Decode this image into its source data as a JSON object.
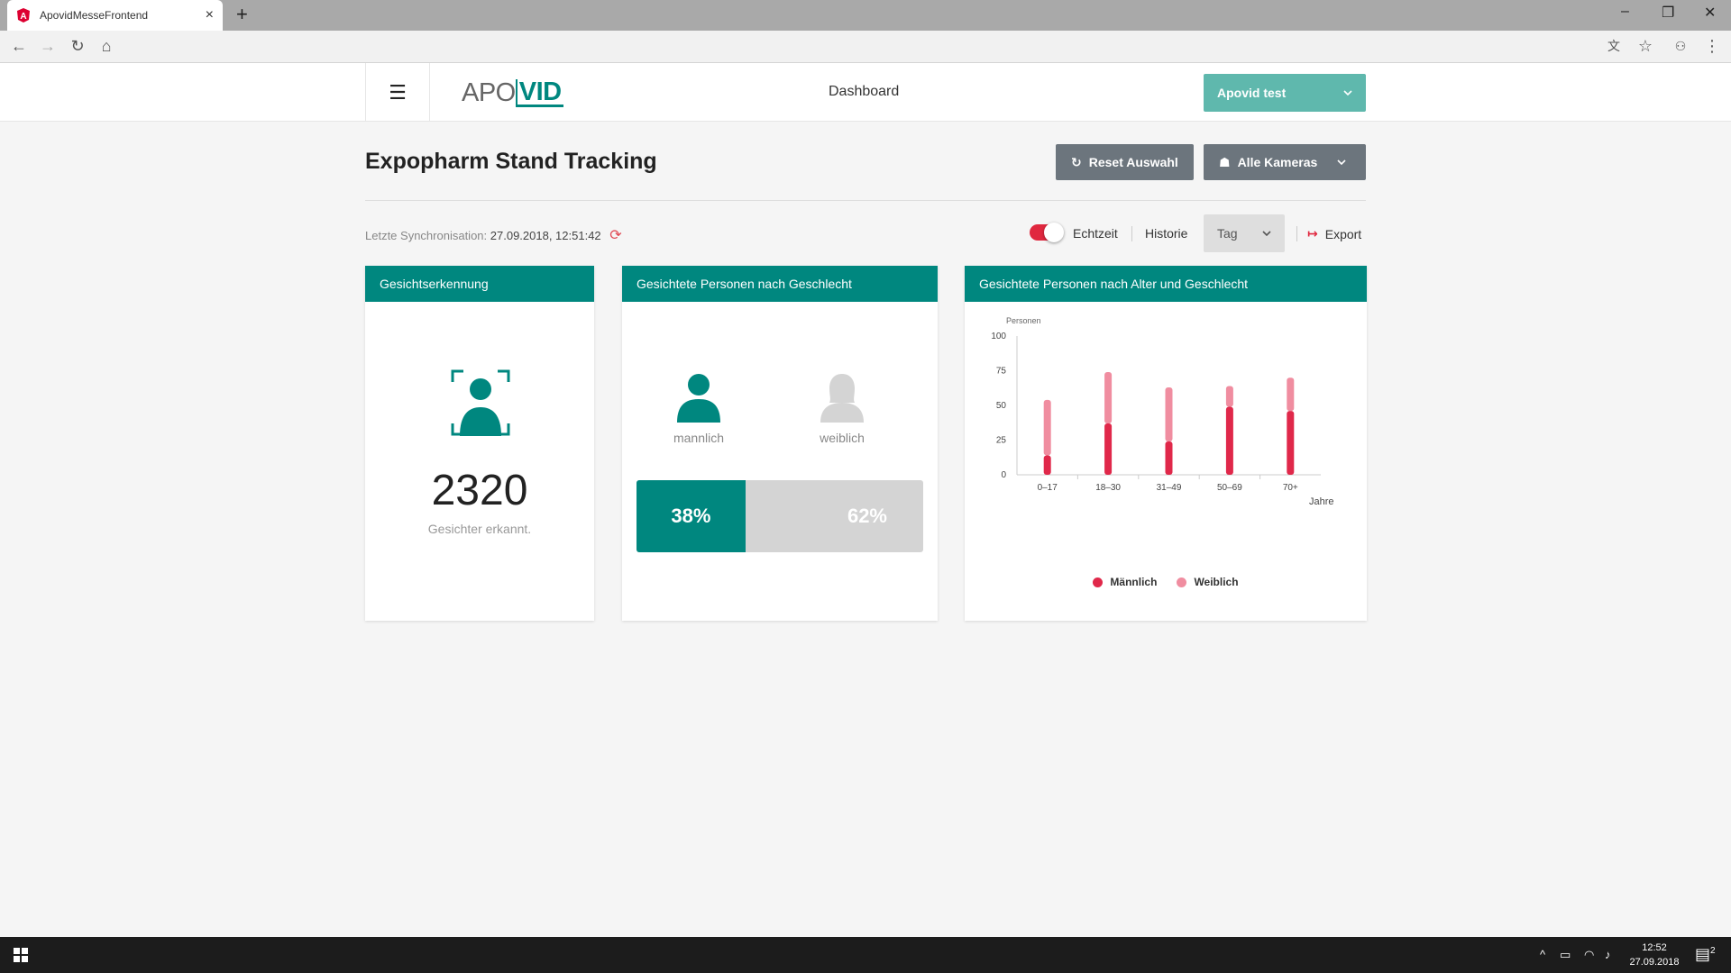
{
  "browser": {
    "tab_title": "ApovidMesseFrontend",
    "tab_close": "×",
    "new_tab": "+",
    "window_controls": [
      "–",
      "❐",
      "✕"
    ]
  },
  "header": {
    "menu_glyph": "☰",
    "logo_apo": "APO",
    "logo_vid": "VID",
    "nav_title": "Dashboard",
    "user_label": "Apovid test"
  },
  "page": {
    "title": "Expopharm Stand Tracking",
    "reset_label": "Reset Auswahl",
    "cameras_label": "Alle Kameras",
    "sync_label": "Letzte Synchronisation:",
    "sync_value": "27.09.2018, 12:51:42",
    "realtime_label": "Echtzeit",
    "realtime_on": true,
    "history_label": "Historie",
    "period_value": "Tag",
    "export_label": "Export"
  },
  "cards": {
    "faces": {
      "title": "Gesichtserkennung",
      "count": "2320",
      "subtitle": "Gesichter erkannt."
    },
    "gender": {
      "title": "Gesichtete Personen nach Geschlecht",
      "male_label": "mannlich",
      "female_label": "weiblich",
      "male_pct": "38%",
      "female_pct": "62%",
      "male_fraction": 0.38
    },
    "age": {
      "title": "Gesichtete Personen nach Alter und Geschlecht"
    }
  },
  "chart_data": {
    "type": "bar",
    "stacked": true,
    "title": "Gesichtete Personen nach Alter und Geschlecht",
    "ylabel": "Personen",
    "xlabel": "Jahre",
    "ylim": [
      0,
      100
    ],
    "yticks": [
      0,
      25,
      50,
      75,
      100
    ],
    "categories": [
      "0–17",
      "18–30",
      "31–49",
      "50–69",
      "70+"
    ],
    "series": [
      {
        "name": "Männlich",
        "color": "#e0284a",
        "values": [
          14,
          37,
          24,
          49,
          46
        ]
      },
      {
        "name": "Weiblich",
        "color": "#f08da0",
        "values": [
          40,
          37,
          39,
          15,
          24
        ]
      }
    ],
    "legend": "bottom",
    "grid": false
  },
  "taskbar": {
    "time": "12:52",
    "date": "27.09.2018",
    "notifications": "2"
  },
  "colors": {
    "teal": "#00877f",
    "teal_light": "#5fb8ad",
    "grey_button": "#6c757d",
    "accent_red": "#e0283f"
  }
}
